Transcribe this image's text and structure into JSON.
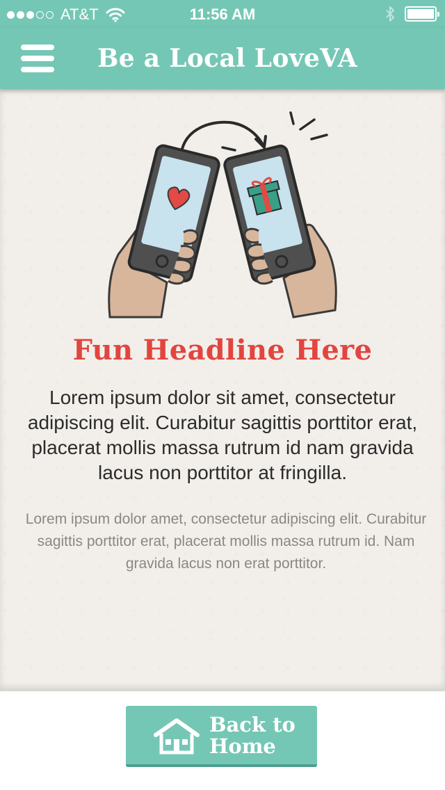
{
  "status_bar": {
    "carrier": "AT&T",
    "time": "11:56 AM",
    "signal_bars_filled": 3,
    "signal_bars_total": 5
  },
  "nav": {
    "title": "Be a Local LoveVA",
    "menu_icon": "hamburger-menu-icon"
  },
  "main": {
    "illustration": "phones-exchanging-love-and-gift",
    "headline": "Fun Headline Here",
    "body": "Lorem ipsum dolor sit amet, consectetur adipiscing elit. Curabitur sagittis porttitor erat, placerat mollis massa rutrum id nam gravida lacus non porttitor at fringilla.",
    "subtext": "Lorem ipsum dolor amet, consectetur adipiscing elit. Curabitur sagittis porttitor erat, placerat mollis massa rutrum id. Nam gravida lacus non erat porttitor."
  },
  "footer": {
    "home_button_line1": "Back to",
    "home_button_line2": "Home",
    "home_icon": "house-icon"
  },
  "colors": {
    "brand_teal": "#74c7b5",
    "headline_red": "#e2453f",
    "paper": "#f2efea"
  }
}
